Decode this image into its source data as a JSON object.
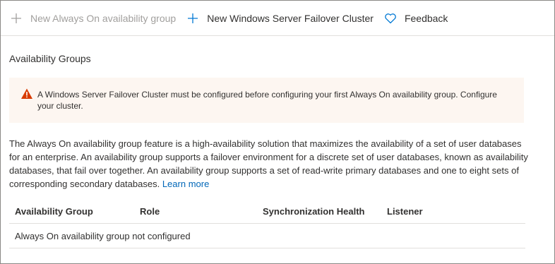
{
  "toolbar": {
    "new_ag_label": "New Always On availability group",
    "new_cluster_label": "New Windows Server Failover Cluster",
    "feedback_label": "Feedback"
  },
  "section_title": "Availability Groups",
  "alert": {
    "text": "A Windows Server Failover Cluster must be configured before configuring your first Always On availability group. Configure your cluster."
  },
  "description": {
    "text": "The Always On availability group feature is a high-availability solution that maximizes the availability of a set of user databases for an enterprise. An availability group supports a failover environment for a discrete set of user databases, known as availability databases, that fail over together. An availability group supports a set of read-write primary databases and one to eight sets of corresponding secondary databases.",
    "link": "Learn more"
  },
  "table": {
    "columns": [
      "Availability Group",
      "Role",
      "Synchronization Health",
      "Listener"
    ],
    "empty_message": "Always On availability group not configured"
  },
  "icons": {
    "new_ag": "plus-icon",
    "new_cluster": "plus-icon",
    "feedback": "heart-icon",
    "alert": "warning-icon"
  },
  "colors": {
    "accent": "#0078d4",
    "link": "#0067b8",
    "warning": "#d83b01",
    "alert_background": "#fdf6f1",
    "disabled_text": "#a19f9d"
  }
}
